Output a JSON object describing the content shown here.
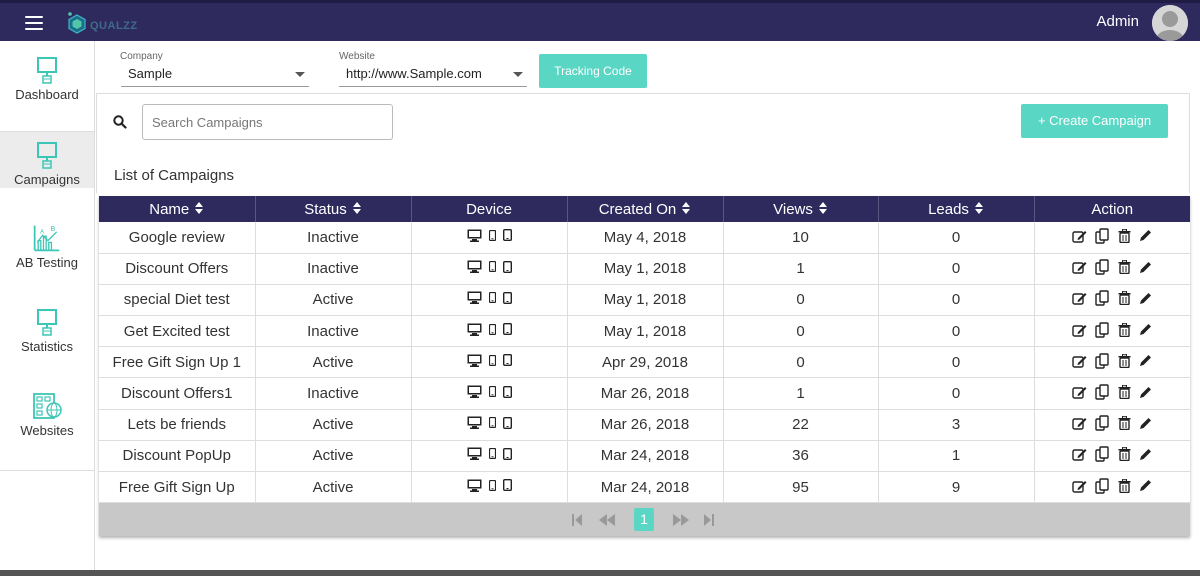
{
  "app": {
    "brand": "QUALZZ",
    "user_name": "Admin"
  },
  "sidebar": {
    "items": [
      {
        "label": "Dashboard",
        "icon": "dashboard-icon"
      },
      {
        "label": "Campaigns",
        "icon": "campaigns-icon",
        "active": true
      },
      {
        "label": "AB Testing",
        "icon": "ab-testing-icon"
      },
      {
        "label": "Statistics",
        "icon": "statistics-icon"
      },
      {
        "label": "Websites",
        "icon": "websites-icon"
      }
    ]
  },
  "filters": {
    "company_label": "Company",
    "company_value": "Sample",
    "website_label": "Website",
    "website_value": "http://www.Sample.com",
    "tracking_button": "Tracking Code"
  },
  "search": {
    "placeholder": "Search Campaigns"
  },
  "create_button": "+ Create Campaign",
  "list_title": "List of Campaigns",
  "table": {
    "headers": [
      "Name",
      "Status",
      "Device",
      "Created On",
      "Views",
      "Leads",
      "Action"
    ],
    "rows": [
      {
        "name": "Google review",
        "status": "Inactive",
        "created": "May 4, 2018",
        "views": "10",
        "leads": "0"
      },
      {
        "name": "Discount Offers",
        "status": "Inactive",
        "created": "May 1, 2018",
        "views": "1",
        "leads": "0"
      },
      {
        "name": "special Diet test",
        "status": "Active",
        "created": "May 1, 2018",
        "views": "0",
        "leads": "0"
      },
      {
        "name": "Get Excited test",
        "status": "Inactive",
        "created": "May 1, 2018",
        "views": "0",
        "leads": "0"
      },
      {
        "name": "Free Gift Sign Up 1",
        "status": "Active",
        "created": "Apr 29, 2018",
        "views": "0",
        "leads": "0"
      },
      {
        "name": "Discount Offers1",
        "status": "Inactive",
        "created": "Mar 26, 2018",
        "views": "1",
        "leads": "0"
      },
      {
        "name": "Lets be friends",
        "status": "Active",
        "created": "Mar 26, 2018",
        "views": "22",
        "leads": "3"
      },
      {
        "name": "Discount PopUp",
        "status": "Active",
        "created": "Mar 24, 2018",
        "views": "36",
        "leads": "1"
      },
      {
        "name": "Free Gift Sign Up",
        "status": "Active",
        "created": "Mar 24, 2018",
        "views": "95",
        "leads": "9"
      }
    ]
  },
  "pagination": {
    "current_page": "1"
  },
  "colors": {
    "header": "#2f2a5e",
    "accent": "#5ad6c4"
  }
}
